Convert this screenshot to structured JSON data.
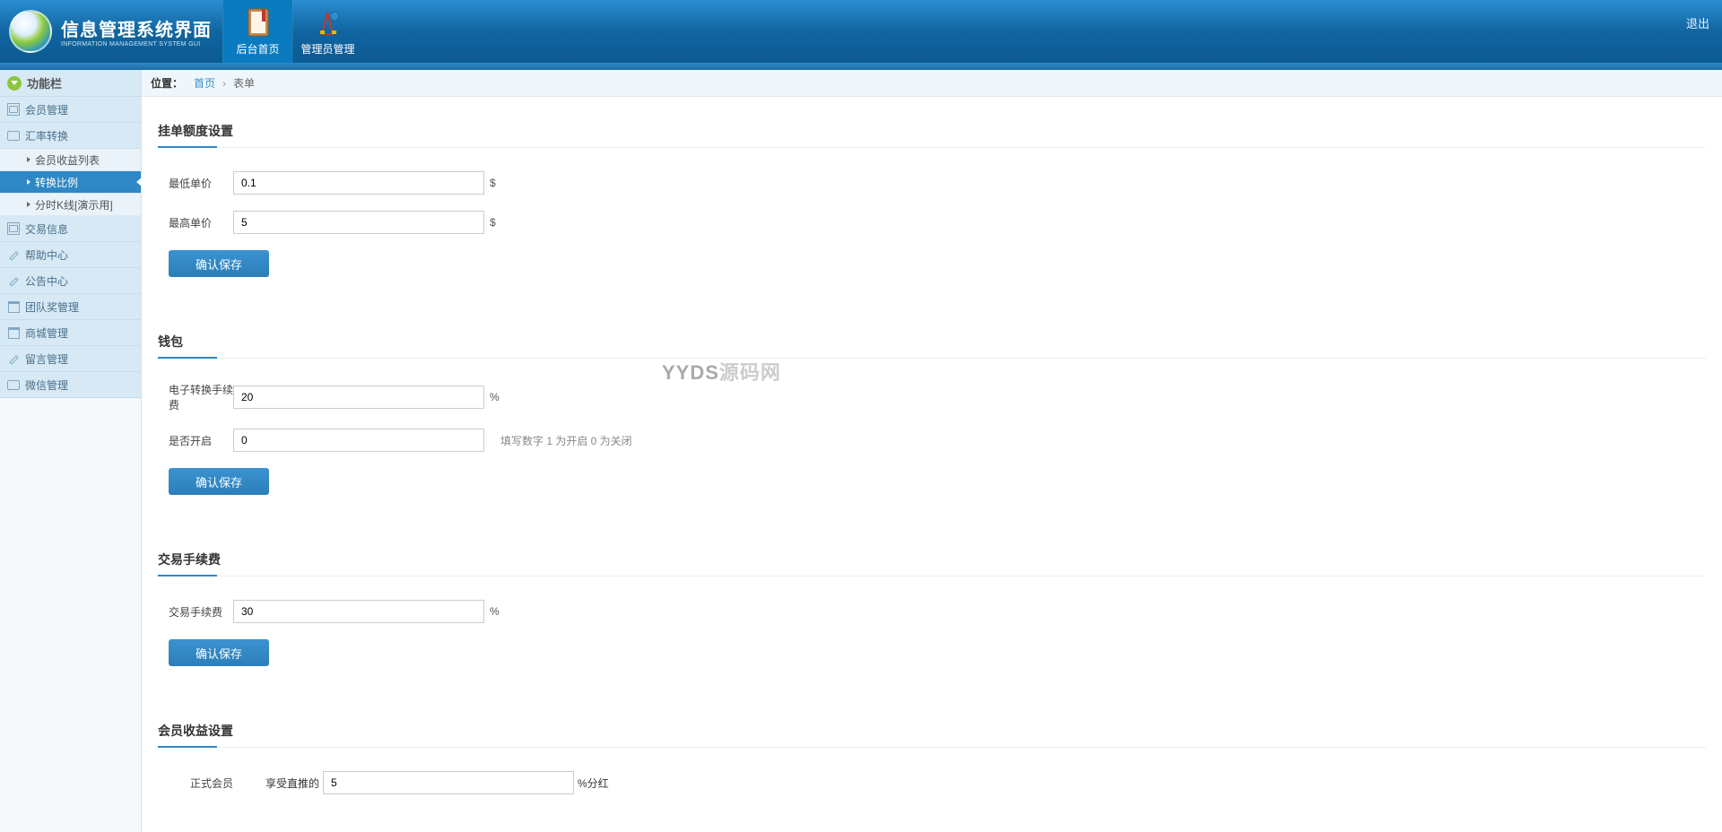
{
  "header": {
    "logo_title": "信息管理系统界面",
    "logo_sub": "INFORMATION MANAGEMENT SYSTEM GUI",
    "nav": [
      {
        "label": "后台首页",
        "active": true
      },
      {
        "label": "管理员管理",
        "active": false
      }
    ],
    "logout": "退出"
  },
  "sidebar": {
    "title": "功能栏",
    "groups": [
      {
        "label": "会员管理",
        "icon": "box"
      },
      {
        "label": "汇率转换",
        "icon": "chat",
        "expanded": true,
        "children": [
          {
            "label": "会员收益列表",
            "active": false
          },
          {
            "label": "转换比例",
            "active": true
          },
          {
            "label": "分时K线[演示用]",
            "active": false
          }
        ]
      },
      {
        "label": "交易信息",
        "icon": "box"
      },
      {
        "label": "帮助中心",
        "icon": "pencil"
      },
      {
        "label": "公告中心",
        "icon": "pencil"
      },
      {
        "label": "团队奖管理",
        "icon": "cal"
      },
      {
        "label": "商城管理",
        "icon": "cal"
      },
      {
        "label": "留言管理",
        "icon": "pencil"
      },
      {
        "label": "微信管理",
        "icon": "chat"
      }
    ]
  },
  "breadcrumb": {
    "prefix": "位置：",
    "home": "首页",
    "sep": "›",
    "current": "表单"
  },
  "section1": {
    "title": "挂单额度设置",
    "min_price_label": "最低单价",
    "min_price_value": "0.1",
    "max_price_label": "最高单价",
    "max_price_value": "5",
    "currency": "$",
    "save": "确认保存"
  },
  "section2": {
    "title": "钱包",
    "fee_label": "电子转换手续费",
    "fee_value": "20",
    "fee_suffix": "%",
    "enable_label": "是否开启",
    "enable_value": "0",
    "enable_hint": "填写数字 1 为开启 0 为关闭",
    "save": "确认保存"
  },
  "section3": {
    "title": "交易手续费",
    "fee_label": "交易手续费",
    "fee_value": "30",
    "fee_suffix": "%",
    "save": "确认保存"
  },
  "section4": {
    "title": "会员收益设置",
    "member_label": "正式会员",
    "direct_prefix": "享受直推的",
    "direct_value": "5",
    "direct_suffix": "%分红"
  },
  "watermark": "YYDS源码网"
}
